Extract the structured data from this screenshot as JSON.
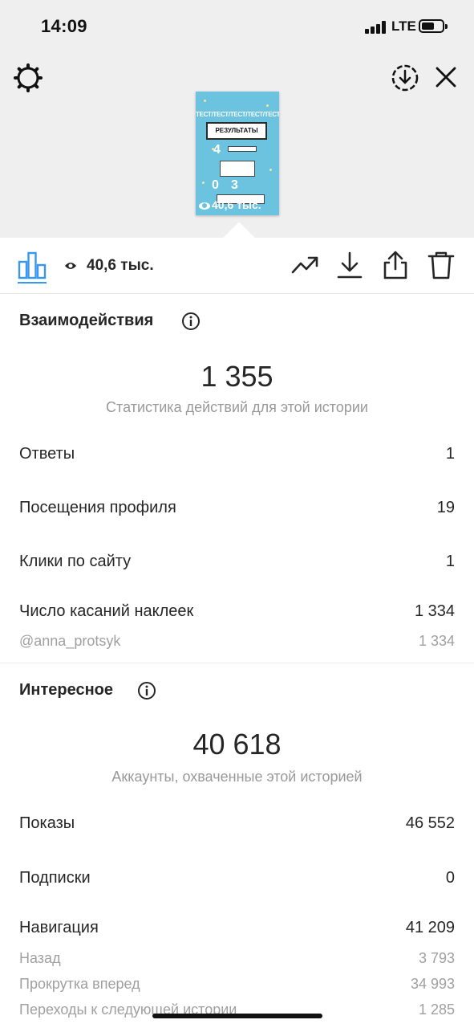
{
  "status_bar": {
    "time": "14:09",
    "network": "LTE"
  },
  "story_preview": {
    "stripe_text": "ТЕСТ/ТЕСТ/ТЕСТ/ТЕСТ/ТЕСТ",
    "title_box": "РЕЗУЛЬТАТЫ",
    "number_a": "4",
    "number_b": "0",
    "number_c": "3",
    "views_overlay": "40,6 тыс."
  },
  "tabs": {
    "views_count": "40,6 тыс."
  },
  "interactions": {
    "title": "Взаимодействия",
    "total": "1 355",
    "caption": "Статистика действий для этой истории",
    "rows": [
      {
        "label": "Ответы",
        "value": "1"
      },
      {
        "label": "Посещения профиля",
        "value": "19"
      },
      {
        "label": "Клики по сайту",
        "value": "1"
      },
      {
        "label": "Число касаний наклеек",
        "value": "1 334"
      }
    ],
    "sub_rows": [
      {
        "label": "@anna_protsyk",
        "value": "1 334"
      }
    ]
  },
  "discovery": {
    "title": "Интересное",
    "total": "40 618",
    "caption": "Аккаунты, охваченные этой историей",
    "rows": [
      {
        "label": "Показы",
        "value": "46 552"
      },
      {
        "label": "Подписки",
        "value": "0"
      },
      {
        "label": "Навигация",
        "value": "41 209"
      }
    ],
    "sub_rows": [
      {
        "label": "Назад",
        "value": "3 793"
      },
      {
        "label": "Прокрутка вперед",
        "value": "34 993"
      },
      {
        "label": "Переходы к следующей истории",
        "value": "1 285"
      }
    ]
  },
  "colors": {
    "accent": "#3897f0",
    "preview_bg": "#6cc3e0",
    "muted": "#999999"
  }
}
